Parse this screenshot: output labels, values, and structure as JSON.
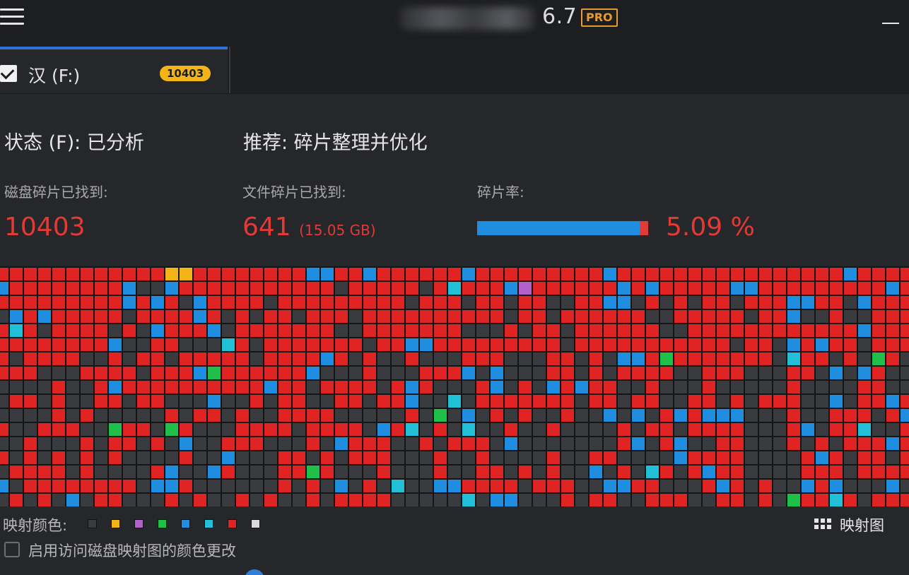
{
  "titlebar": {
    "version": "6.7",
    "pro_badge": "PRO"
  },
  "tab": {
    "label": "汉 (F:)",
    "badge": "10403",
    "checked": true
  },
  "status": {
    "text": "状态 (F): 已分析"
  },
  "recommendation": {
    "text": "推荐: 碎片整理并优化"
  },
  "stats": {
    "disk_fragments_label": "磁盘碎片已找到:",
    "disk_fragments_value": "10403",
    "file_fragments_label": "文件碎片已找到:",
    "file_fragments_value": "641",
    "file_fragments_size": "(15.05 GB)",
    "fragmentation_label": "碎片率:",
    "fragmentation_value": "5.09 %",
    "fragmentation_fraction": 0.0509
  },
  "legend": {
    "label": "映射颜色:",
    "colors": [
      "#3a3b3f",
      "#f2b417",
      "#b35fc9",
      "#1fbf4a",
      "#1f8ee0",
      "#22c0d6",
      "#e02424",
      "#d9d9d9"
    ]
  },
  "map_view": {
    "label": "映射图"
  },
  "color_change_option": {
    "label": "启用访问磁盘映射图的颜色更改",
    "checked": false
  },
  "colors": {
    "accent_blue": "#2f73d6",
    "fragment_red": "#e23a35",
    "badge_yellow": "#f2b417",
    "pro_orange": "#e89a2a"
  }
}
